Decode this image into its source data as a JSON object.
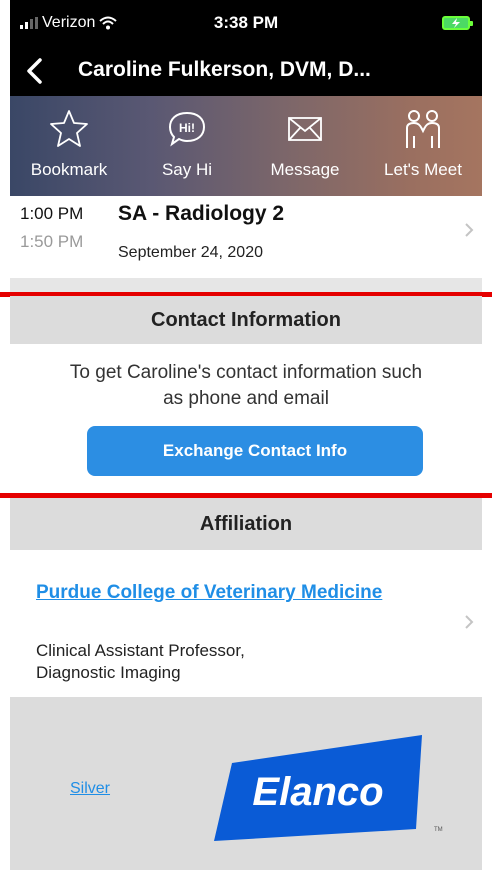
{
  "status_bar": {
    "carrier": "Verizon",
    "time": "3:38 PM"
  },
  "nav": {
    "title": "Caroline Fulkerson, DVM, D..."
  },
  "actions": [
    {
      "label": "Bookmark",
      "icon": "star-icon"
    },
    {
      "label": "Say Hi",
      "icon": "hi-bubble-icon"
    },
    {
      "label": "Message",
      "icon": "envelope-icon"
    },
    {
      "label": "Let's Meet",
      "icon": "meet-people-icon"
    }
  ],
  "session": {
    "start": "1:00 PM",
    "end": "1:50 PM",
    "title": "SA - Radiology 2",
    "date": "September 24, 2020"
  },
  "contact": {
    "header": "Contact Information",
    "text_line1": "To get Caroline's contact information such",
    "text_line2": "as phone and email",
    "button": "Exchange Contact Info"
  },
  "affiliation": {
    "header": "Affiliation",
    "organization": "Purdue College of Veterinary Medicine",
    "position_line1": "Clinical Assistant Professor,",
    "position_line2": "Diagnostic Imaging"
  },
  "sponsor": {
    "level": "Silver",
    "logo_text": "Elanco",
    "trademark": "TM"
  },
  "colors": {
    "accent_blue": "#2c8ee3",
    "link_blue": "#1f8ee6",
    "annotation_red": "#e50000",
    "elanco_blue": "#0a5bd6"
  }
}
